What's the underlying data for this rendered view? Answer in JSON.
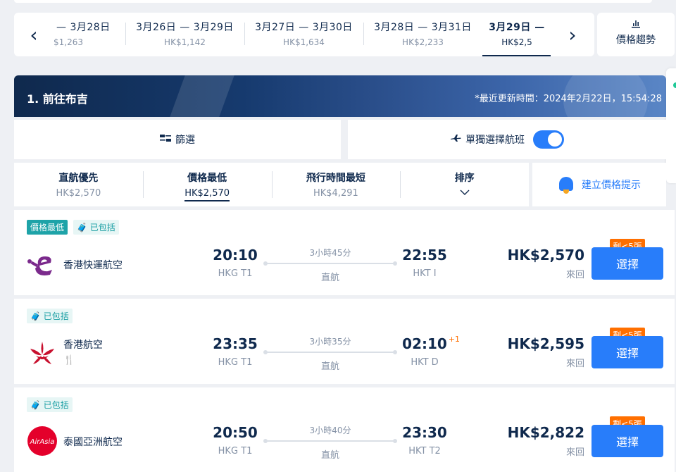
{
  "dates": [
    {
      "range": "— 3月28日",
      "price": "$1,263"
    },
    {
      "range": "3月26日 — 3月29日",
      "price": "HK$1,142"
    },
    {
      "range": "3月27日 — 3月30日",
      "price": "HK$1,634"
    },
    {
      "range": "3月28日 — 3月31日",
      "price": "HK$2,233"
    },
    {
      "range": "3月29日 —",
      "price": "HK$2,5"
    }
  ],
  "trend_label": "價格趨勢",
  "banner": {
    "title": "1. 前往布吉",
    "updated": "*最近更新時間：2024年2月22日，15:54:28"
  },
  "filter_label": "篩選",
  "single_label": "單獨選擇航班",
  "sort": [
    {
      "title": "直航優先",
      "value": "HK$2,570"
    },
    {
      "title": "價格最低",
      "value": "HK$2,570"
    },
    {
      "title": "飛行時間最短",
      "value": "HK$4,291"
    },
    {
      "title": "排序",
      "value": ""
    }
  ],
  "price_alert": "建立價格提示",
  "flights": [
    {
      "tags": [
        "價格最低",
        "已包括"
      ],
      "airline": "香港快運航空",
      "meal": "",
      "dep_time": "20:10",
      "dep_apt": "HKG T1",
      "duration": "3小時45分",
      "stops": "直航",
      "arr_time": "22:55",
      "arr_day": "",
      "arr_apt": "HKT I",
      "price": "HK$2,570",
      "trip": "來回",
      "seats": "剩<5張",
      "select": "選擇"
    },
    {
      "tags": [
        "已包括"
      ],
      "airline": "香港航空",
      "meal": "🍴",
      "dep_time": "23:35",
      "dep_apt": "HKG T1",
      "duration": "3小時35分",
      "stops": "直航",
      "arr_time": "02:10",
      "arr_day": "+1",
      "arr_apt": "HKT D",
      "price": "HK$2,595",
      "trip": "來回",
      "seats": "剩<5張",
      "select": "選擇"
    },
    {
      "tags": [
        "已包括"
      ],
      "airline": "泰國亞洲航空",
      "meal": "",
      "dep_time": "20:50",
      "dep_apt": "HKG T1",
      "duration": "3小時40分",
      "stops": "直航",
      "arr_time": "23:30",
      "arr_day": "",
      "arr_apt": "HKT T2",
      "price": "HK$2,822",
      "trip": "來回",
      "seats": "剩<5張",
      "select": "選擇"
    }
  ],
  "logos": {
    "airasia": "AirAsia"
  },
  "colors": {
    "accent": "#287dfa",
    "badge": "#ff6f00",
    "teal": "#1ea3a8",
    "navy": "#0f294d"
  }
}
